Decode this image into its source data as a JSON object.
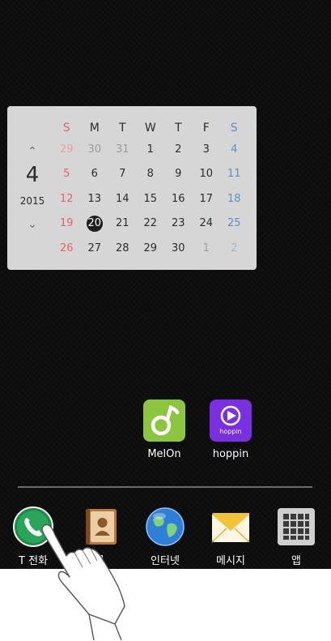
{
  "calendar": {
    "month": "4",
    "year": "2015",
    "up_glyph": "⌃",
    "down_glyph": "⌄",
    "weekdays": [
      "S",
      "M",
      "T",
      "W",
      "T",
      "F",
      "S"
    ],
    "weeks": [
      [
        "29",
        "30",
        "31",
        "1",
        "2",
        "3",
        "4"
      ],
      [
        "5",
        "6",
        "7",
        "8",
        "9",
        "10",
        "11"
      ],
      [
        "12",
        "13",
        "14",
        "15",
        "16",
        "17",
        "18"
      ],
      [
        "19",
        "20",
        "21",
        "22",
        "23",
        "24",
        "25"
      ],
      [
        "26",
        "27",
        "28",
        "29",
        "30",
        "1",
        "2"
      ]
    ],
    "today": "20"
  },
  "apps": {
    "melon": {
      "label": "MelOn",
      "icon": "melon-note-icon",
      "color": "#8cc63f"
    },
    "hoppin": {
      "label": "hoppin",
      "icon": "hoppin-play-icon",
      "color": "#7a2fe0",
      "brand": "hoppin"
    }
  },
  "dock": {
    "phone": {
      "label": "T 전화",
      "icon": "phone-icon",
      "color": "#2aa55a"
    },
    "contacts": {
      "label": "록",
      "icon": "contacts-book-icon",
      "color": "#b9773e"
    },
    "internet": {
      "label": "인터넷",
      "icon": "globe-icon",
      "color": "#2f7fd6"
    },
    "messages": {
      "label": "메시지",
      "icon": "envelope-icon",
      "color": "#f2c33a"
    },
    "apps": {
      "label": "앱",
      "icon": "app-grid-icon",
      "color": "#cfcfcf"
    }
  }
}
